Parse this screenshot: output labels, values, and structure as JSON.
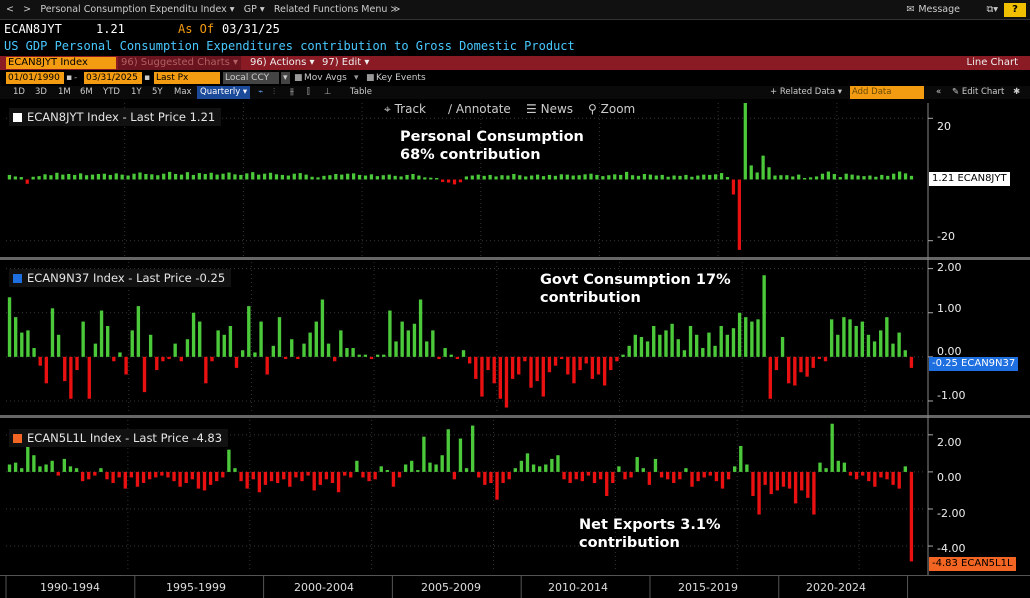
{
  "topnav": {
    "title_dropdown": "Personal Consumption Expenditu Index ▾",
    "gp_dropdown": "GP ▾",
    "related_menu": "Related Functions Menu ≫",
    "message": "Message",
    "help": "?"
  },
  "header": {
    "ticker": "ECAN8JYT",
    "price": "1.21",
    "asof_label": "As Of",
    "asof_date": "03/31/25",
    "description": "US GDP Personal Consumption Expenditures contribution to Gross Domestic Product"
  },
  "toolbar": {
    "security_field": "ECAN8JYT Index",
    "suggested": "96) Suggested Charts ▾",
    "actions": "96) Actions ▾",
    "edit": "97) Edit ▾",
    "chart_type": "Line Chart"
  },
  "datebar": {
    "start_date": "01/01/1990",
    "end_date": "03/31/2025",
    "field": "Last Px",
    "currency": "Local CCY",
    "mov_avgs": "Mov Avgs",
    "key_events": "Key Events"
  },
  "rangebar": {
    "ranges": [
      "1D",
      "3D",
      "1M",
      "6M",
      "YTD",
      "1Y",
      "5Y",
      "Max"
    ],
    "period": "Quarterly ▾",
    "table": "Table",
    "related_data": "+ Related Data ▾",
    "add_data": "Add Data",
    "edit_chart": "✎ Edit Chart"
  },
  "chart_tools": {
    "track": "Track",
    "annotate": "Annotate",
    "news": "News",
    "zoom": "Zoom"
  },
  "colors": {
    "positive": "#4bc93a",
    "negative": "#e81010",
    "accent_orange": "#f39c12",
    "label_blue": "#1e6fe0",
    "label_orange": "#f26522"
  },
  "chart_data": [
    {
      "type": "bar",
      "legend": "ECAN8JYT Index - Last Price 1.21",
      "legend_color": "#ffffff",
      "annotation": [
        "Personal Consumption",
        "68% contribution"
      ],
      "y_ticks": [
        "20",
        "-20"
      ],
      "last_label": "1.21 ECAN8JYT",
      "last_label_bg": "#ffffff",
      "last_label_fg": "#000000",
      "ylim": [
        -25,
        25
      ],
      "values": [
        1.5,
        1.0,
        0.8,
        -1.4,
        0.9,
        1.1,
        1.7,
        1.4,
        2.2,
        1.6,
        1.8,
        1.5,
        2.0,
        1.4,
        1.6,
        1.8,
        1.9,
        1.5,
        2.0,
        1.6,
        1.3,
        1.9,
        2.3,
        1.8,
        1.7,
        1.4,
        1.9,
        2.5,
        1.8,
        1.6,
        2.4,
        1.5,
        2.1,
        1.8,
        2.2,
        1.6,
        1.9,
        2.3,
        1.7,
        1.5,
        2.0,
        2.4,
        1.6,
        1.9,
        2.2,
        1.7,
        1.5,
        1.3,
        1.9,
        2.1,
        1.6,
        0.9,
        0.7,
        1.2,
        1.4,
        1.8,
        1.6,
        1.9,
        2.0,
        1.5,
        1.3,
        1.7,
        1.1,
        1.4,
        1.6,
        1.2,
        1.0,
        1.5,
        1.8,
        1.3,
        0.7,
        0.6,
        0.5,
        -0.8,
        -1.0,
        -1.6,
        -0.9,
        1.0,
        1.3,
        1.6,
        1.2,
        1.5,
        1.0,
        1.4,
        1.3,
        1.8,
        1.4,
        1.0,
        1.3,
        1.6,
        1.1,
        1.5,
        1.2,
        1.7,
        1.6,
        1.3,
        1.4,
        1.7,
        1.9,
        1.5,
        1.1,
        1.4,
        1.7,
        1.5,
        2.5,
        1.4,
        1.2,
        1.8,
        1.6,
        1.3,
        1.5,
        0.9,
        1.3,
        1.2,
        1.5,
        0.9,
        1.3,
        1.6,
        1.5,
        1.7,
        2.1,
        0.8,
        -4.9,
        -23.0,
        25.0,
        4.6,
        2.3,
        7.8,
        4.0,
        1.3,
        1.4,
        1.4,
        1.0,
        1.6,
        0.5,
        0.7,
        1.0,
        1.9,
        2.6,
        1.8,
        0.8,
        1.9,
        1.6,
        1.3,
        1.1,
        1.3,
        0.9,
        1.5,
        1.2,
        1.9,
        2.6,
        2.0,
        1.2
      ]
    },
    {
      "type": "bar",
      "legend": "ECAN9N37 Index - Last Price -0.25",
      "legend_color": "#1e6fe0",
      "annotation": [
        "Govt Consumption 17%",
        "contribution"
      ],
      "y_ticks": [
        "2.00",
        "1.00",
        "0.00",
        "-1.00"
      ],
      "last_label": "-0.25 ECAN9N37",
      "last_label_bg": "#1e6fe0",
      "last_label_fg": "#ffffff",
      "ylim": [
        -1.25,
        2.15
      ],
      "values": [
        1.35,
        0.9,
        0.55,
        0.6,
        0.2,
        -0.2,
        -0.6,
        1.1,
        0.5,
        -0.55,
        -0.95,
        -0.3,
        0.8,
        -0.95,
        0.3,
        1.05,
        0.7,
        -0.1,
        0.1,
        -0.4,
        0.6,
        1.15,
        -0.8,
        0.5,
        -0.3,
        -0.1,
        -0.05,
        0.3,
        -0.1,
        0.4,
        1.0,
        0.8,
        -0.6,
        -0.1,
        0.6,
        0.5,
        0.7,
        -0.25,
        0.15,
        1.15,
        0.1,
        0.8,
        -0.4,
        0.25,
        0.9,
        -0.05,
        0.4,
        -0.05,
        0.3,
        0.55,
        0.8,
        1.3,
        0.3,
        -0.1,
        0.6,
        0.2,
        0.2,
        0.05,
        0.05,
        -0.05,
        0.05,
        0.05,
        1.05,
        0.35,
        0.8,
        0.6,
        0.75,
        1.3,
        0.35,
        0.6,
        -0.05,
        0.2,
        0.05,
        -0.05,
        0.15,
        -0.15,
        -0.5,
        -0.9,
        -0.3,
        -0.6,
        -0.95,
        -1.15,
        -0.5,
        -0.4,
        -0.1,
        -0.7,
        -0.55,
        -0.9,
        -0.35,
        -0.2,
        -0.05,
        -0.4,
        -0.6,
        -0.3,
        -0.15,
        -0.5,
        -0.4,
        -0.65,
        -0.3,
        -0.1,
        0.05,
        0.25,
        0.5,
        0.45,
        0.35,
        0.7,
        0.5,
        0.6,
        0.75,
        0.4,
        0.15,
        0.7,
        0.5,
        0.2,
        0.55,
        0.25,
        0.7,
        0.5,
        0.65,
        1.0,
        0.9,
        0.8,
        0.85,
        1.85,
        -0.95,
        -0.3,
        0.45,
        -0.6,
        -0.65,
        -0.35,
        -0.45,
        -0.25,
        -0.05,
        -0.1,
        0.85,
        0.5,
        0.9,
        0.85,
        0.7,
        0.8,
        0.5,
        0.35,
        0.6,
        0.9,
        0.3,
        0.55,
        0.15,
        -0.25
      ]
    },
    {
      "type": "bar",
      "legend": "ECAN5L1L Index - Last Price -4.83",
      "legend_color": "#f26522",
      "annotation": [
        "Net Exports 3.1%",
        "contribution"
      ],
      "y_ticks": [
        "2.00",
        "0.00",
        "-2.00",
        "-4.00"
      ],
      "last_label": "-4.83 ECAN5L1L",
      "last_label_bg": "#f26522",
      "last_label_fg": "#000000",
      "ylim": [
        -5.4,
        2.8
      ],
      "values": [
        0.4,
        0.5,
        0.2,
        1.4,
        0.9,
        0.3,
        0.4,
        0.6,
        -0.2,
        0.7,
        0.3,
        0.2,
        -0.5,
        -0.4,
        -0.2,
        0.2,
        -0.4,
        -0.6,
        -0.3,
        -0.9,
        -0.3,
        -0.8,
        -0.6,
        -0.4,
        -0.3,
        -0.2,
        -0.3,
        -0.5,
        -0.8,
        -0.6,
        -0.4,
        -0.9,
        -1.0,
        -0.7,
        -0.5,
        -0.3,
        1.2,
        0.2,
        -0.5,
        -0.9,
        -0.4,
        -1.1,
        -0.7,
        -0.5,
        -0.6,
        -0.4,
        -0.8,
        -0.3,
        -0.5,
        -0.2,
        -1.0,
        -0.7,
        -0.4,
        -0.6,
        -1.1,
        -0.2,
        -0.3,
        0.6,
        -0.3,
        -0.5,
        -0.4,
        0.3,
        0.1,
        -0.8,
        -0.3,
        0.4,
        0.6,
        0.1,
        1.9,
        0.5,
        0.4,
        0.9,
        2.3,
        -0.4,
        1.8,
        0.2,
        2.5,
        -0.3,
        -0.7,
        -0.6,
        -1.5,
        -0.6,
        -0.4,
        0.2,
        0.6,
        1.0,
        0.4,
        0.3,
        0.4,
        0.7,
        0.9,
        -0.4,
        -0.6,
        -0.4,
        -0.5,
        -0.2,
        -0.6,
        -0.4,
        -1.3,
        -0.6,
        0.3,
        -0.4,
        -0.3,
        0.8,
        0.2,
        -0.7,
        0.7,
        -0.3,
        -0.4,
        -0.6,
        -0.4,
        0.2,
        -0.8,
        -0.5,
        -0.3,
        -0.2,
        -0.5,
        -0.9,
        -0.4,
        0.3,
        1.4,
        0.4,
        -1.3,
        -2.3,
        -0.7,
        -1.2,
        -1.0,
        -0.8,
        -0.9,
        -1.7,
        -1.0,
        -1.4,
        -2.3,
        0.5,
        0.2,
        2.6,
        0.6,
        0.5,
        -0.2,
        -0.4,
        -0.2,
        -0.5,
        -0.8,
        -0.3,
        -0.4,
        -0.7,
        -0.9,
        0.3,
        -4.83
      ]
    }
  ],
  "x_axis": {
    "labels": [
      "1990-1994",
      "1995-1999",
      "2000-2004",
      "2005-2009",
      "2010-2014",
      "2015-2019",
      "2020-2024"
    ]
  }
}
